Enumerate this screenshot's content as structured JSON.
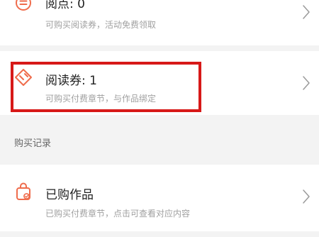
{
  "colors": {
    "accent": "#ef6c4c",
    "highlight": "#d71918",
    "background": "#f3f3f3",
    "card": "#ffffff",
    "title": "#222222",
    "subtitle": "#a0a0a0"
  },
  "items": [
    {
      "title": "阅点: 0",
      "subtitle": "可购买阅读券，活动免费领取",
      "icon": "list-icon"
    },
    {
      "title": "阅读券: 1",
      "subtitle": "可购买付费章节，与作品绑定",
      "icon": "ticket-icon"
    }
  ],
  "section": {
    "label": "购买记录"
  },
  "purchased": {
    "title": "已购作品",
    "subtitle": "已购买付费章节，点击可查看对应内容",
    "icon": "shopping-bag-icon"
  }
}
